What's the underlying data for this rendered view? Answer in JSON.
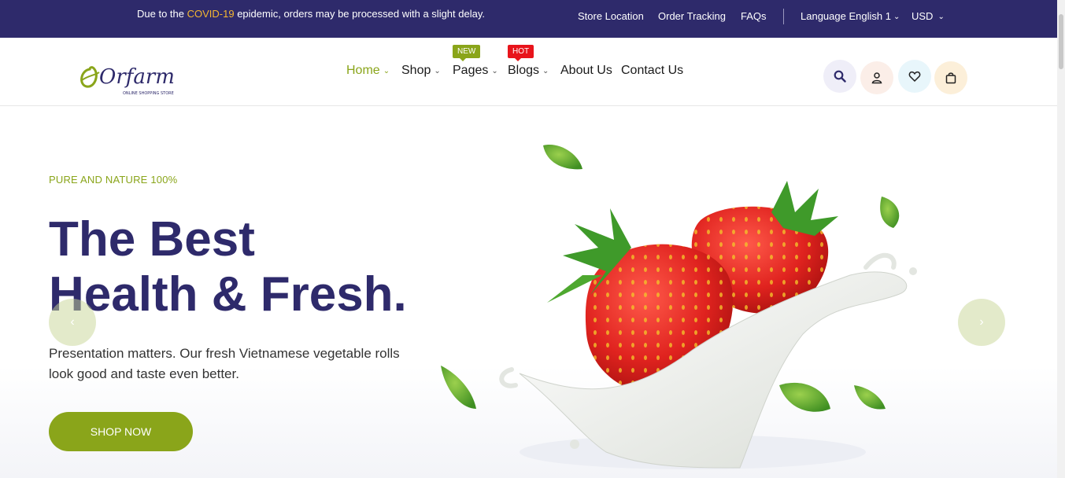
{
  "topbar": {
    "notice_pre": "Due to the ",
    "notice_highlight": "COVID-19",
    "notice_post": " epidemic, orders may be processed with a slight delay.",
    "links": {
      "store_location": "Store Location",
      "order_tracking": "Order Tracking",
      "faqs": "FAQs",
      "language": "Language English 1",
      "currency": "USD"
    }
  },
  "header": {
    "logo_text": "Orfarm",
    "logo_tagline": "ONLINE SHOPPING STORE",
    "nav": {
      "home": "Home",
      "shop": "Shop",
      "pages": "Pages",
      "blogs": "Blogs",
      "about": "About Us",
      "contact": "Contact Us"
    },
    "badges": {
      "new": "NEW",
      "hot": "HOT"
    }
  },
  "hero": {
    "tagline": "PURE AND NATURE 100%",
    "headline_line1": "The Best",
    "headline_line2": "Health & Fresh.",
    "description": "Presentation matters. Our fresh Vietnamese vegetable rolls look good and taste even better.",
    "button": "SHOP NOW",
    "prev_arrow": "‹",
    "next_arrow": "›"
  },
  "colors": {
    "brand_navy": "#2e2a6b",
    "brand_green": "#8aa51a",
    "highlight": "#f5b731",
    "hot_red": "#e8141b"
  },
  "icons": [
    "search-icon",
    "user-icon",
    "heart-icon",
    "bag-icon",
    "chevron-left-icon",
    "chevron-right-icon"
  ]
}
